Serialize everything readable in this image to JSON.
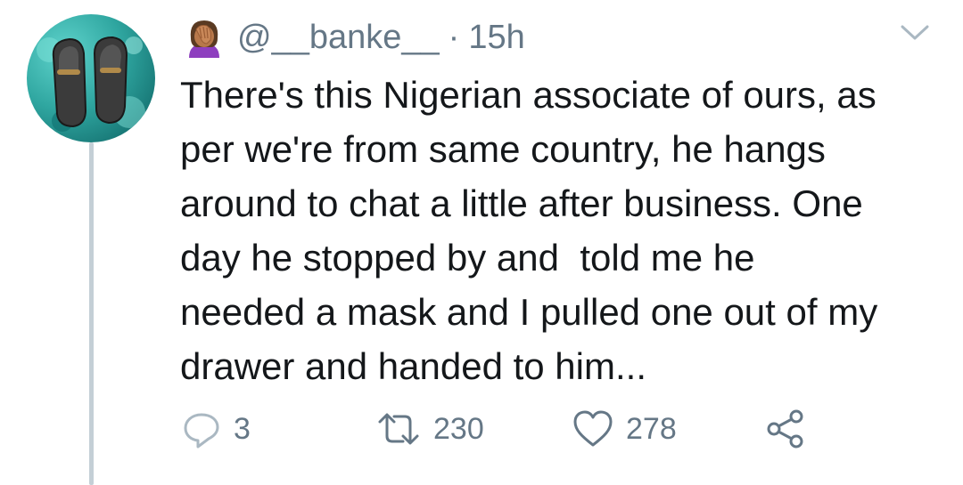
{
  "tweet": {
    "handle": "@__banke__",
    "separator": "·",
    "time": "15h",
    "text": "There's this Nigerian associate of ours, as\nper we're from same country, he hangs\naround to chat a little after business. One\nday he stopped by and  told me he\nneeded a mask and I pulled one out of my\ndrawer and handed to him...",
    "reply_count": "3",
    "retweet_count": "230",
    "like_count": "278"
  },
  "icons": {
    "name_emoji": "facepalm-emoji-icon",
    "menu": "chevron-down-icon",
    "reply": "reply-icon",
    "retweet": "retweet-icon",
    "like": "heart-icon",
    "share": "share-icon"
  },
  "colors": {
    "text": "#14171a",
    "meta": "#657786",
    "thread_line": "#c4cfd6"
  }
}
